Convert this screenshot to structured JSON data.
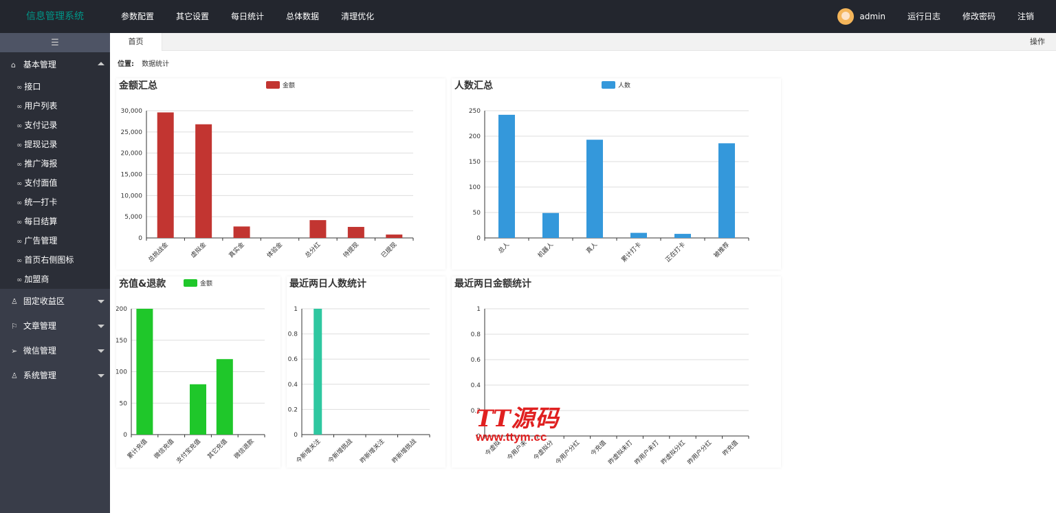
{
  "app": {
    "brand": "信息管理系统"
  },
  "topnav": [
    "参数配置",
    "其它设置",
    "每日统计",
    "总体数据",
    "清理优化"
  ],
  "topright": {
    "user": "admin",
    "items": [
      "运行日志",
      "修改密码",
      "注销"
    ]
  },
  "sidebar": {
    "groups": [
      {
        "label": "基本管理",
        "icon": "home-icon",
        "expanded": true,
        "items": [
          "接口",
          "用户列表",
          "支付记录",
          "提现记录",
          "推广海报",
          "支付面值",
          "统一打卡",
          "每日结算",
          "广告管理",
          "首页右侧图标",
          "加盟商"
        ]
      },
      {
        "label": "固定收益区",
        "icon": "user-group-icon",
        "expanded": false,
        "items": []
      },
      {
        "label": "文章管理",
        "icon": "flag-icon",
        "expanded": false,
        "items": []
      },
      {
        "label": "微信管理",
        "icon": "send-icon",
        "expanded": false,
        "items": []
      },
      {
        "label": "系统管理",
        "icon": "user-icon",
        "expanded": false,
        "items": []
      }
    ]
  },
  "tabs": {
    "home": "首页",
    "ops": "操作"
  },
  "breadcrumb": {
    "label": "位置:",
    "value": "数据统计"
  },
  "watermark": {
    "line1": "TT源码",
    "line2": "www.ttym.cc"
  },
  "colors": {
    "red": "#c23531",
    "blue": "#3498db",
    "green": "#1fc72a",
    "teal": "#2ec7a0"
  },
  "chart_data": [
    {
      "title": "金额汇总",
      "type": "bar",
      "legend": "金额",
      "color": "#c23531",
      "categories": [
        "总挑战金",
        "虚拟金",
        "真实金",
        "体验金",
        "总分红",
        "待提现",
        "已提现"
      ],
      "values": [
        29600,
        26800,
        2700,
        0,
        4200,
        2600,
        800
      ],
      "ylim": [
        0,
        30000
      ],
      "yticks": [
        0,
        5000,
        10000,
        15000,
        20000,
        25000,
        30000
      ]
    },
    {
      "title": "人数汇总",
      "type": "bar",
      "legend": "人数",
      "color": "#3498db",
      "categories": [
        "总人",
        "机器人",
        "真人",
        "累计打卡",
        "正在打卡",
        "被推荐"
      ],
      "values": [
        242,
        49,
        193,
        10,
        8,
        186
      ],
      "ylim": [
        0,
        250
      ],
      "yticks": [
        0,
        50,
        100,
        150,
        200,
        250
      ]
    },
    {
      "title": "充值&退款",
      "type": "bar",
      "legend": "金额",
      "color": "#1fc72a",
      "categories": [
        "累计充值",
        "微信充值",
        "支付宝充值",
        "其它充值",
        "微信退款"
      ],
      "values": [
        200,
        0,
        80,
        120,
        0
      ],
      "ylim": [
        0,
        200
      ],
      "yticks": [
        0,
        50,
        100,
        150,
        200
      ]
    },
    {
      "title": "最近两日人数统计",
      "type": "bar",
      "legend": "",
      "color": "#2ec7a0",
      "categories": [
        "今新增关注",
        "今新增挑战",
        "昨新增关注",
        "昨新增挑战"
      ],
      "values": [
        1,
        0,
        0,
        0
      ],
      "ylim": [
        0,
        1
      ],
      "yticks": [
        0,
        0.2,
        0.4,
        0.6,
        0.8,
        1
      ]
    },
    {
      "title": "最近两日金额统计",
      "type": "bar",
      "legend": "",
      "color": "#c23531",
      "categories": [
        "今虚拟",
        "今用户未",
        "今虚拟分",
        "今用户分红",
        "今充值",
        "昨虚拟未打",
        "昨用户未打",
        "昨虚拟分红",
        "昨用户分红",
        "昨充值"
      ],
      "values": [
        0,
        0,
        0,
        0,
        0,
        0,
        0,
        0,
        0,
        0
      ],
      "ylim": [
        0,
        1
      ],
      "yticks": [
        0,
        0.2,
        0.4,
        0.6,
        0.8,
        1
      ]
    }
  ]
}
